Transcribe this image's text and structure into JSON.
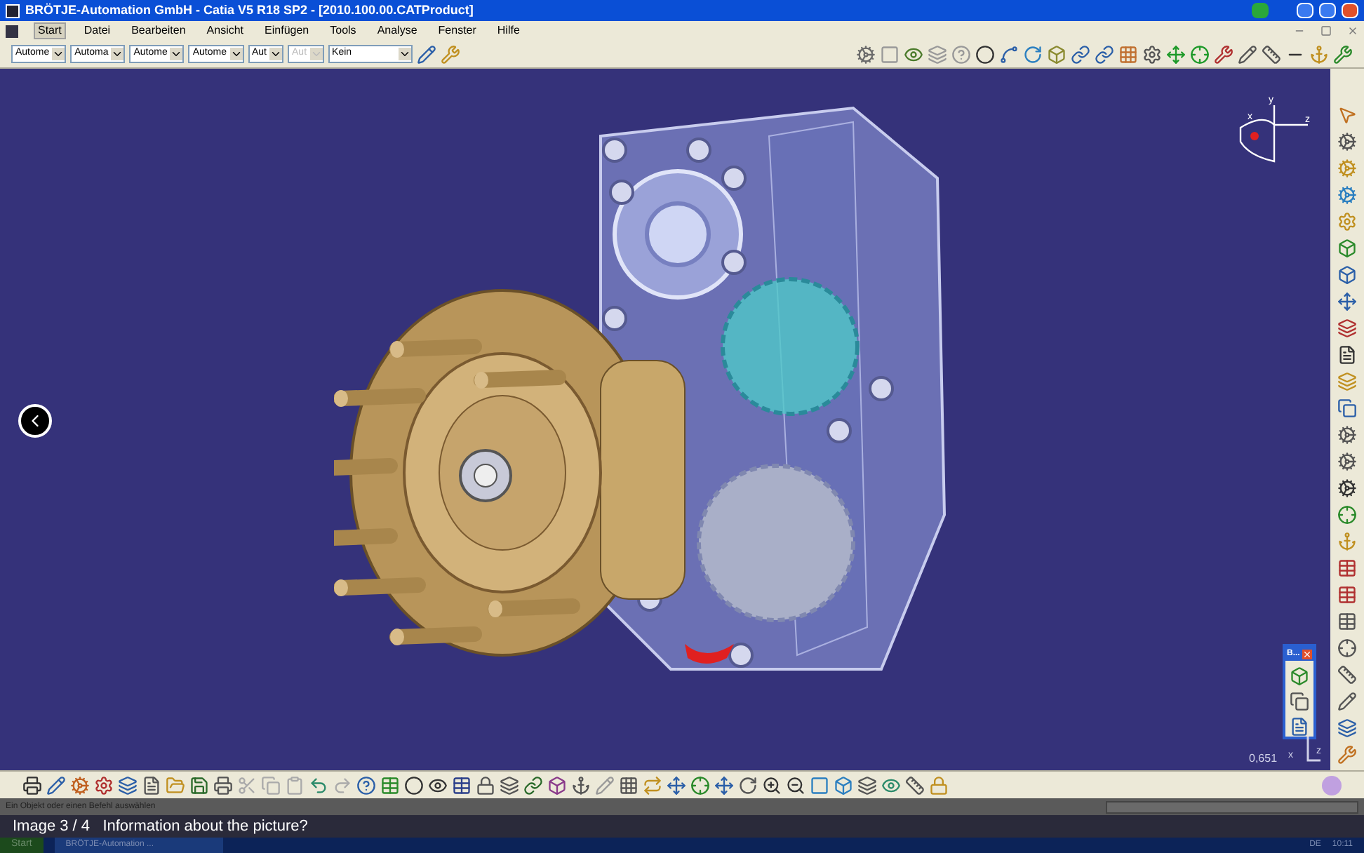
{
  "window": {
    "title": "BRÖTJE-Automation GmbH - Catia V5 R18 SP2 - [2010.100.00.CATProduct]"
  },
  "menu": [
    {
      "label": "Start",
      "selected": true
    },
    {
      "label": "Datei",
      "selected": false
    },
    {
      "label": "Bearbeiten",
      "selected": false
    },
    {
      "label": "Ansicht",
      "selected": false
    },
    {
      "label": "Einfügen",
      "selected": false
    },
    {
      "label": "Tools",
      "selected": false
    },
    {
      "label": "Analyse",
      "selected": false
    },
    {
      "label": "Fenster",
      "selected": false
    },
    {
      "label": "Hilfe",
      "selected": false
    }
  ],
  "format_toolbar": [
    {
      "value": "Autome",
      "disabled": false
    },
    {
      "value": "Automa",
      "disabled": false
    },
    {
      "value": "Autome",
      "disabled": false
    },
    {
      "value": "Autome",
      "disabled": false
    },
    {
      "value": "Aut",
      "disabled": false
    },
    {
      "value": "Aut",
      "disabled": true
    },
    {
      "value": "Kein",
      "disabled": false
    }
  ],
  "compass": {
    "x": "x",
    "y": "y",
    "z": "z"
  },
  "mini_toolbar": {
    "title": "B..."
  },
  "viewport": {
    "scale": "0,651",
    "axis_x": "x",
    "axis_z": "z"
  },
  "status_bar": {
    "text": "Ein Objekt oder einen Befehl auswählen"
  },
  "taskbar": {
    "start": "Start",
    "task": "BRÖTJE-Automation ...",
    "language": "DE",
    "clock": "10:11"
  },
  "gallery": {
    "caption": "Image 3 / 4   Information about the picture?"
  }
}
